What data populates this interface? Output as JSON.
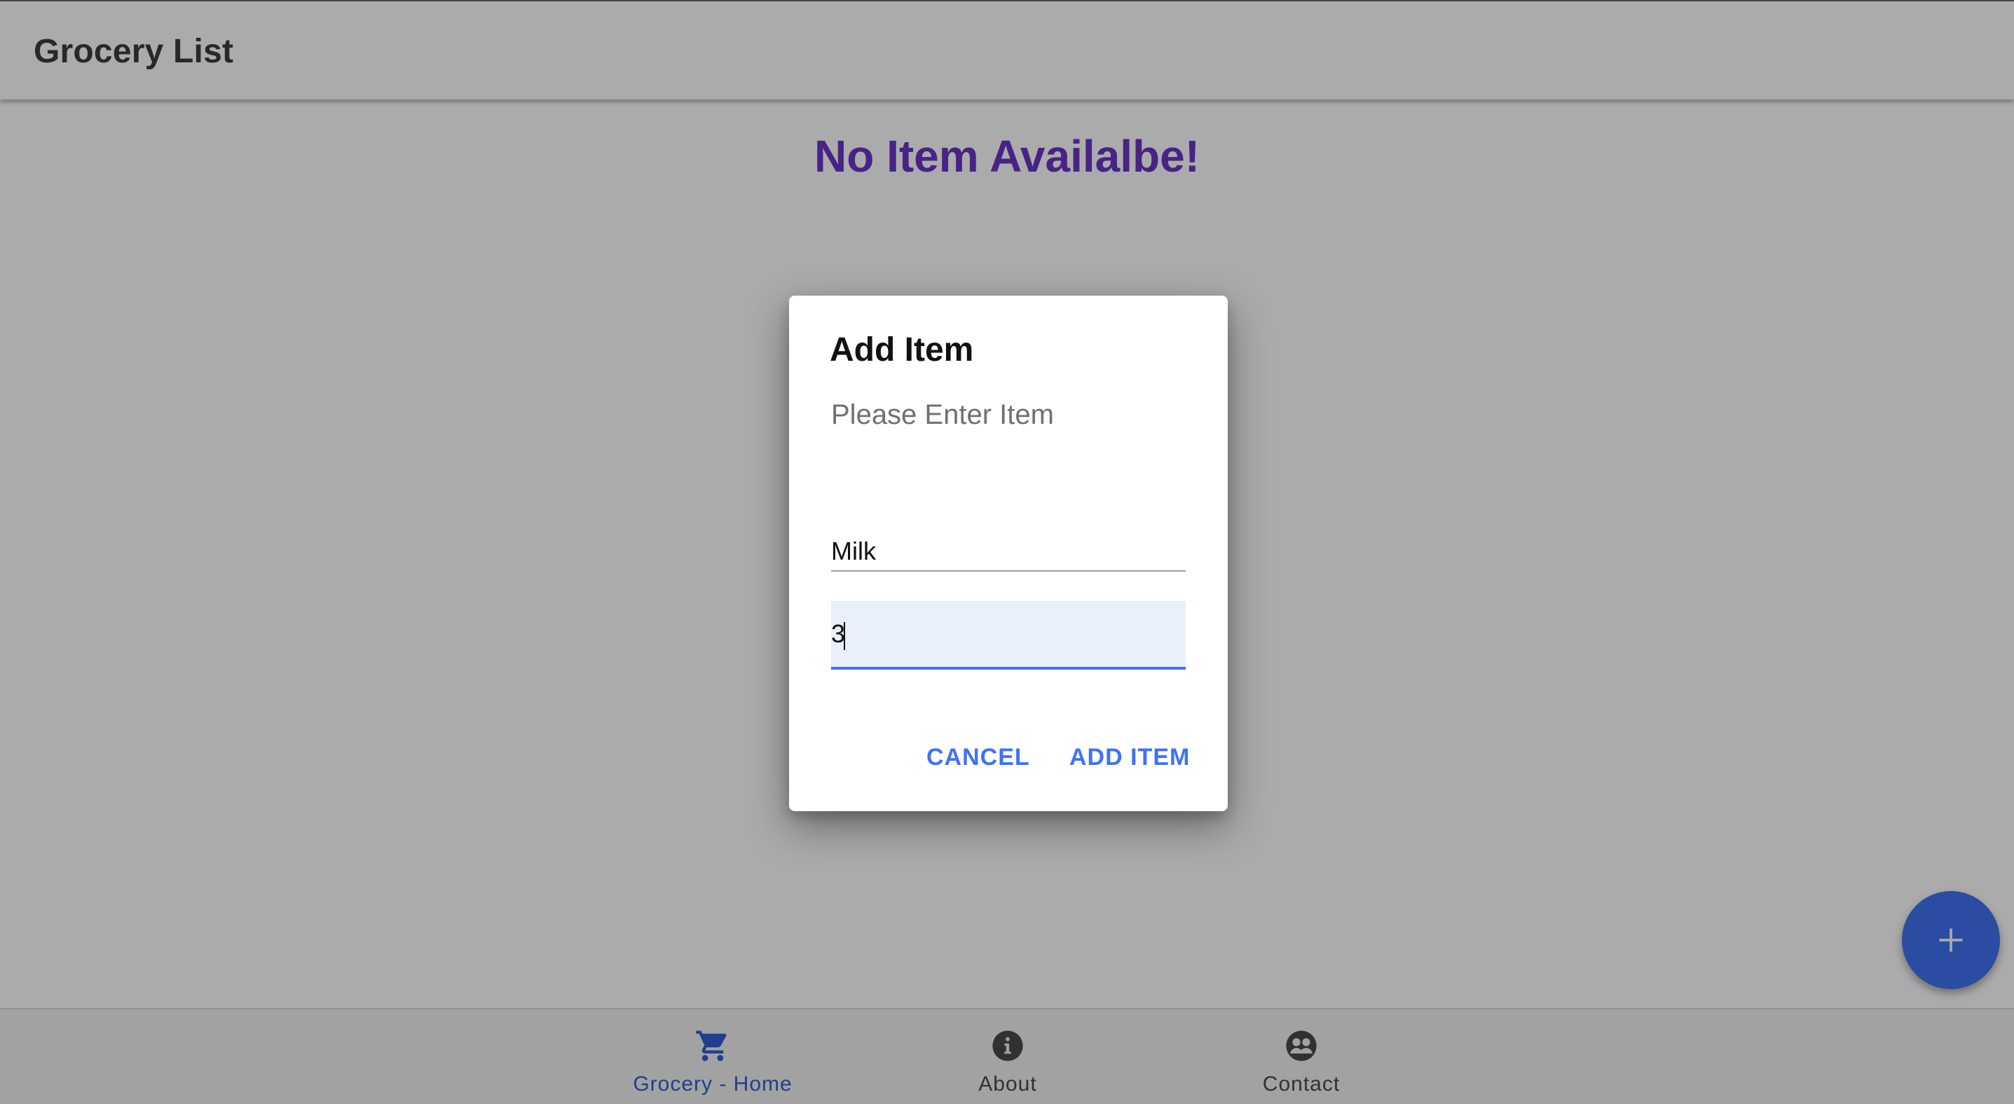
{
  "app": {
    "title": "Grocery List",
    "empty_message": "No Item Availalbe!"
  },
  "bottom_nav": {
    "items": [
      {
        "label": "Grocery - Home",
        "icon": "cart-icon",
        "active": true
      },
      {
        "label": "About",
        "icon": "info-icon",
        "active": false
      },
      {
        "label": "Contact",
        "icon": "contacts-icon",
        "active": false
      }
    ]
  },
  "fab": {
    "icon": "plus-icon"
  },
  "dialog": {
    "title": "Add Item",
    "text": "Please Enter Item",
    "item_field": {
      "value": "Milk"
    },
    "quantity_field": {
      "value": "3"
    },
    "cancel_label": "CANCEL",
    "add_label": "ADD ITEM"
  },
  "colors": {
    "accent": "#3f73f2",
    "empty_message": "#6a35c8"
  }
}
